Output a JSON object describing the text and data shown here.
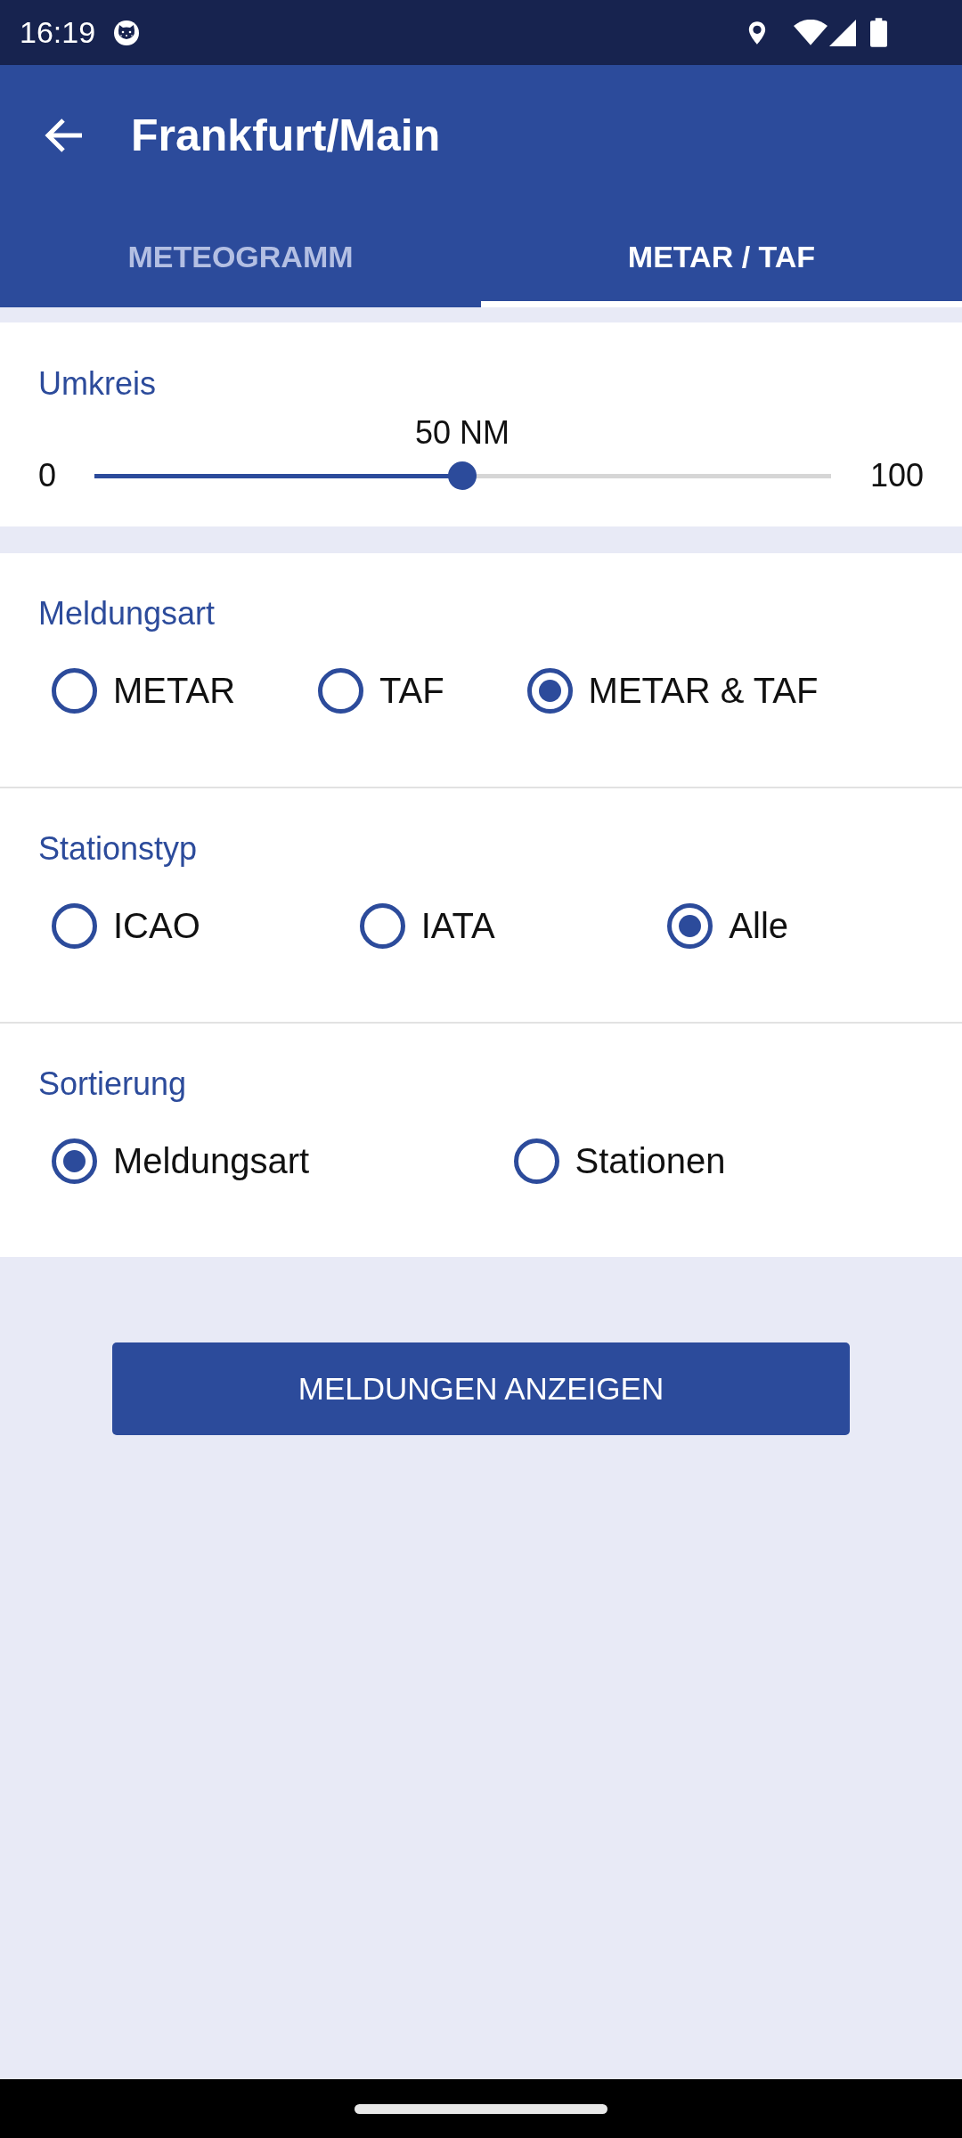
{
  "status_bar": {
    "time": "16:19"
  },
  "app_bar": {
    "title": "Frankfurt/Main"
  },
  "tabs": [
    {
      "label": "METEOGRAMM",
      "selected": false
    },
    {
      "label": "METAR / TAF",
      "selected": true
    }
  ],
  "radius": {
    "label": "Umkreis",
    "value_label": "50 NM",
    "min_label": "0",
    "max_label": "100",
    "level": 0.5
  },
  "option_groups": [
    {
      "label": "Meldungsart",
      "options": [
        {
          "label": "METAR",
          "selected": false
        },
        {
          "label": "TAF",
          "selected": false
        },
        {
          "label": "METAR & TAF",
          "selected": true
        }
      ]
    },
    {
      "label": "Stationstyp",
      "options": [
        {
          "label": "ICAO",
          "selected": false
        },
        {
          "label": "IATA",
          "selected": false
        },
        {
          "label": "Alle",
          "selected": true
        }
      ]
    },
    {
      "label": "Sortierung",
      "options": [
        {
          "label": "Meldungsart",
          "selected": true
        },
        {
          "label": "Stationen",
          "selected": false
        }
      ]
    }
  ],
  "button": {
    "label": "MELDUNGEN ANZEIGEN"
  }
}
